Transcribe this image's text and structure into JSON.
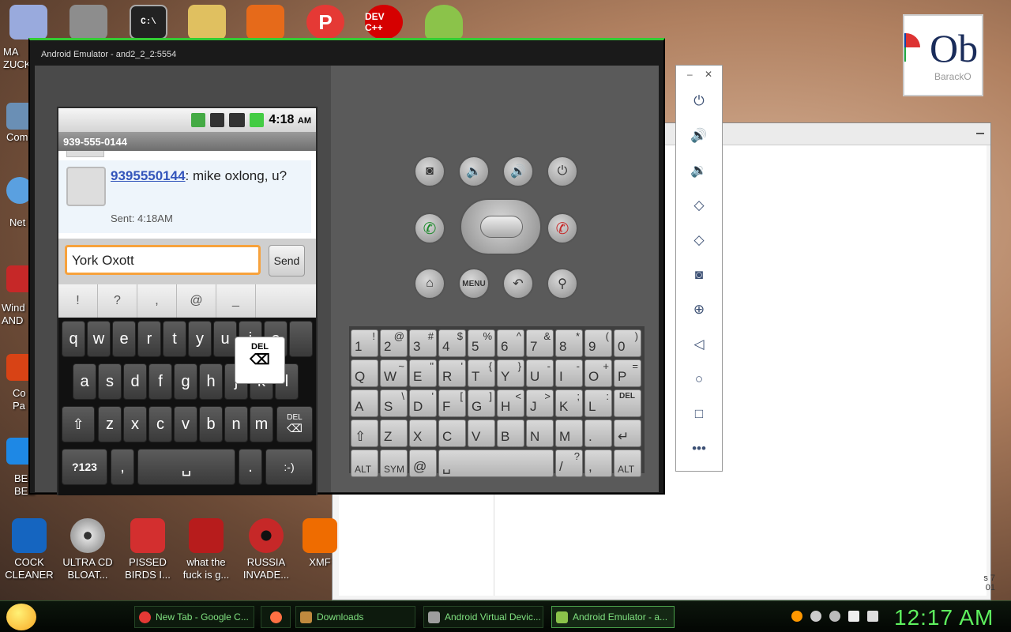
{
  "desktop": {
    "icons": [
      {
        "label": "COCK\nCLEANER",
        "icon": "cleaner-icon",
        "color": "#1565c0"
      },
      {
        "label": "ULTRA CD\nBLOAT...",
        "icon": "cd-icon",
        "color": "#9e9e9e"
      },
      {
        "label": "PISSED\nBIRDS I...",
        "icon": "birds-icon",
        "color": "#d32f2f"
      },
      {
        "label": "what the\nfuck is g...",
        "icon": "birds-space-icon",
        "color": "#b71c1c"
      },
      {
        "label": "RUSSIA\nINVADE...",
        "icon": "radiation-icon",
        "color": "#c62828"
      },
      {
        "label": "XMF",
        "icon": "xampp-icon",
        "color": "#ef6c00"
      }
    ],
    "left_labels": [
      "MA\nZUCK",
      "Com",
      "Net",
      "Wind\nAND",
      "Co\nPa",
      "BE\nBEE"
    ],
    "top_icons": [
      {
        "icon": "folder-icon",
        "color": "#8d8d8d",
        "text": ""
      },
      {
        "icon": "cmd-icon",
        "color": "#222222",
        "text": "C:\\"
      },
      {
        "icon": "scanner-icon",
        "color": "#e0c060",
        "text": ""
      },
      {
        "icon": "angry-birds-pig-icon",
        "color": "#e66a1a",
        "text": ""
      },
      {
        "icon": "p-icon",
        "color": "#e53935",
        "text": "P"
      },
      {
        "icon": "devcpp-icon",
        "color": "#d50000",
        "text": "DEV C++"
      },
      {
        "icon": "android-icon",
        "color": "#8bc34a",
        "text": ""
      }
    ],
    "poster": {
      "big": "Ob",
      "small": "BarackO"
    }
  },
  "emulator": {
    "title": "Android Emulator - and2_2_2:5554",
    "status": {
      "time": "4:18",
      "ampm": "AM"
    },
    "conversation_title": "939-555-0144",
    "message": {
      "sender": "9395550144",
      "text": ": mike oxlong, u?",
      "sent": "Sent: 4:18AM"
    },
    "compose_value": "York Oxott",
    "send_label": "Send",
    "candidates": [
      "!",
      "?",
      ",",
      "@",
      "_"
    ],
    "del_popup": "DEL",
    "keyboard": {
      "row1": [
        "q",
        "w",
        "e",
        "r",
        "t",
        "y",
        "u",
        "i",
        "o"
      ],
      "row2": [
        "a",
        "s",
        "d",
        "f",
        "g",
        "h",
        "j",
        "k",
        "l"
      ],
      "row3": [
        "z",
        "x",
        "c",
        "v",
        "b",
        "n",
        "m"
      ],
      "del": "DEL",
      "sym": "?123",
      "comma": ",",
      "period": ".",
      "smiley": ":-)"
    },
    "hw_keys": {
      "row1": [
        [
          "1",
          "!"
        ],
        [
          "2",
          "@"
        ],
        [
          "3",
          "#"
        ],
        [
          "4",
          "$"
        ],
        [
          "5",
          "%"
        ],
        [
          "6",
          "^"
        ],
        [
          "7",
          "&"
        ],
        [
          "8",
          "*"
        ],
        [
          "9",
          "("
        ],
        [
          "0",
          ")"
        ]
      ],
      "row2": [
        [
          "Q",
          ""
        ],
        [
          "W",
          "~"
        ],
        [
          "E",
          "\""
        ],
        [
          "R",
          "'"
        ],
        [
          "T",
          "{"
        ],
        [
          "Y",
          "}"
        ],
        [
          "U",
          "-"
        ],
        [
          "I",
          "-"
        ],
        [
          "O",
          "+"
        ],
        [
          "P",
          "="
        ]
      ],
      "row3": [
        [
          "A",
          ""
        ],
        [
          "S",
          "\\"
        ],
        [
          "D",
          "'"
        ],
        [
          "F",
          "["
        ],
        [
          "G",
          "]"
        ],
        [
          "H",
          "<"
        ],
        [
          "J",
          ">"
        ],
        [
          "K",
          ";"
        ],
        [
          "L",
          ":"
        ]
      ],
      "row3_del": "DEL",
      "row4": [
        [
          "Z",
          ""
        ],
        [
          "X",
          ""
        ],
        [
          "C",
          ""
        ],
        [
          "V",
          ""
        ],
        [
          "B",
          ""
        ],
        [
          "N",
          ""
        ],
        [
          "M",
          ""
        ],
        [
          ".",
          ""
        ]
      ],
      "alt": "ALT",
      "sym": "SYM",
      "at": "@",
      "slash": "/",
      "q": "?",
      "comma": ","
    },
    "hw_buttons": {
      "menu": "MENU"
    }
  },
  "taskbar": {
    "items": [
      {
        "label": "New Tab - Google C...",
        "color": "#e53935"
      },
      {
        "label": "",
        "color": "#ff7043"
      },
      {
        "label": "Downloads",
        "color": "#c08a3e"
      },
      {
        "label": "Android Virtual Devic...",
        "color": "#9e9e9e"
      },
      {
        "label": "Android Emulator - a...",
        "color": "#8bc34a"
      }
    ],
    "clock": "12:17 AM"
  },
  "bgwin": {
    "edge_text": "s 7\n01"
  }
}
